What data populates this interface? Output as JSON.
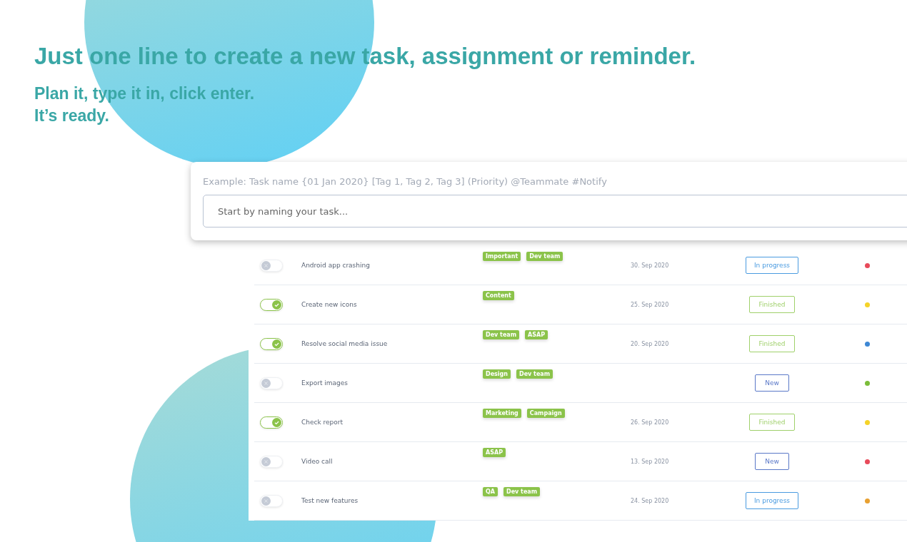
{
  "headline": "Just one line to create a new task, assignment or reminder.",
  "subline": [
    "Plan it, type it in, click enter.",
    "It’s ready."
  ],
  "composer": {
    "hint": "Example: Task name {01 Jan 2020} [Tag 1, Tag 2, Tag 3] (Priority) @Teammate #Notify",
    "placeholder": "Start by naming your task..."
  },
  "tasks": [
    {
      "done": false,
      "name": "Android app crashing",
      "tags": [
        "Important",
        "Dev team"
      ],
      "date": "30. Sep 2020",
      "status": {
        "label": "In progress",
        "kind": "progress"
      },
      "color": "#e84a5a"
    },
    {
      "done": true,
      "name": "Create new icons",
      "tags": [
        "Content"
      ],
      "date": "25. Sep 2020",
      "status": {
        "label": "Finished",
        "kind": "finished"
      },
      "color": "#f5d328"
    },
    {
      "done": true,
      "name": "Resolve social media issue",
      "tags": [
        "Dev team",
        "ASAP"
      ],
      "date": "20. Sep 2020",
      "status": {
        "label": "Finished",
        "kind": "finished"
      },
      "color": "#3d87d4"
    },
    {
      "done": false,
      "name": "Export images",
      "tags": [
        "Design",
        "Dev team"
      ],
      "status": {
        "label": "New",
        "kind": "new"
      },
      "color": "#7bbd3a"
    },
    {
      "done": true,
      "name": "Check report",
      "tags": [
        "Marketing",
        "Campaign"
      ],
      "date": "26. Sep 2020",
      "status": {
        "label": "Finished",
        "kind": "finished"
      },
      "color": "#f5d328"
    },
    {
      "done": false,
      "name": "Video call",
      "tags": [
        "ASAP"
      ],
      "date": "13. Sep 2020",
      "status": {
        "label": "New",
        "kind": "new"
      },
      "color": "#e84a5a"
    },
    {
      "done": false,
      "name": "Test new features",
      "tags": [
        "QA",
        "Dev team"
      ],
      "date": "24. Sep 2020",
      "status": {
        "label": "In progress",
        "kind": "progress"
      },
      "color": "#e8a030"
    }
  ]
}
